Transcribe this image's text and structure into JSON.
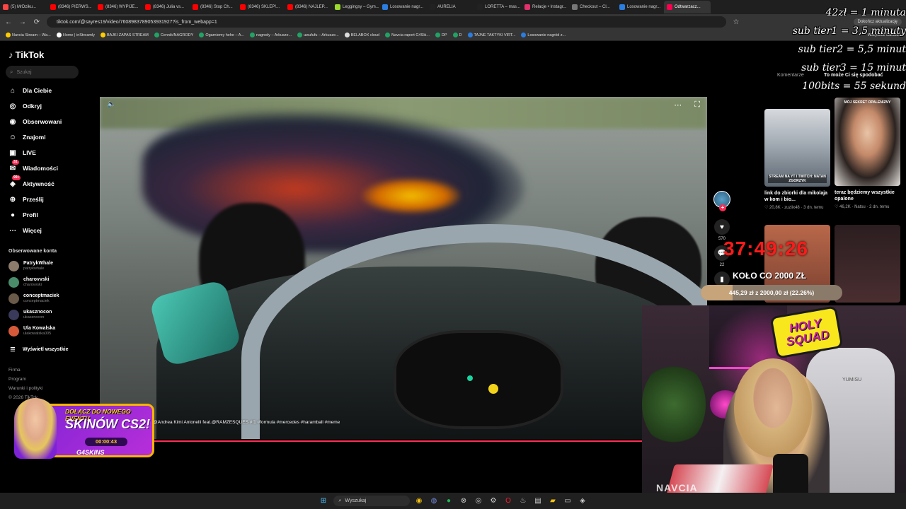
{
  "browser": {
    "tabs": [
      {
        "label": "(5) MrDziku...",
        "color": "#ff4444",
        "active": false
      },
      {
        "label": "(8346) PIERWS...",
        "color": "#ff0000",
        "active": false
      },
      {
        "label": "(8346) WYPIJE...",
        "color": "#ff0000",
        "active": false
      },
      {
        "label": "(8346) Julia vs...",
        "color": "#ff0000",
        "active": false
      },
      {
        "label": "(8346) Stop Ch...",
        "color": "#ff0000",
        "active": false
      },
      {
        "label": "(8346) SKLEP!...",
        "color": "#ff0000",
        "active": false
      },
      {
        "label": "(8346) NAJLEP...",
        "color": "#ff0000",
        "active": false
      },
      {
        "label": "Leggingsy – Gym...",
        "color": "#9cd92d",
        "active": false
      },
      {
        "label": "Losowanie nagr...",
        "color": "#2a7de1",
        "active": false
      },
      {
        "label": "AURELIA",
        "color": "#222222",
        "active": false
      },
      {
        "label": "LORETTA – mas...",
        "color": "#222222",
        "active": false
      },
      {
        "label": "Relacje • Instagr...",
        "color": "#e1306c",
        "active": false
      },
      {
        "label": "Checkout – Cl...",
        "color": "#777777",
        "active": false
      },
      {
        "label": "Losowanie nagr...",
        "color": "#2a7de1",
        "active": false
      },
      {
        "label": "Odtwarzacz...",
        "color": "#ff0050",
        "active": true
      }
    ],
    "url": "tiktok.com/@sayres19/video/7608983789053931927?is_from_webapp=1",
    "update_label": "Dokończ aktualizację",
    "all_bookmarks": "Wszystkie zakładki",
    "bookmarks": [
      {
        "label": "Navcia Stream – Wa...",
        "color": "#ffcc00"
      },
      {
        "label": "Home | inStreamly",
        "color": "#ffffff"
      },
      {
        "label": "BAJKI ZAPAS STREAM",
        "color": "#ffcc00"
      },
      {
        "label": "Cennik/NAGRODY",
        "color": "#21a366"
      },
      {
        "label": "Ogarniemy hehe – A...",
        "color": "#21a366"
      },
      {
        "label": "nagrody – Arkusze...",
        "color": "#21a366"
      },
      {
        "label": "uwufufu – Arkusze...",
        "color": "#21a366"
      },
      {
        "label": "BELABOX cloud",
        "color": "#dddddd"
      },
      {
        "label": "Navcia raport G4Ski...",
        "color": "#21a366"
      },
      {
        "label": "DP",
        "color": "#21a366"
      },
      {
        "label": "D",
        "color": "#21a366"
      },
      {
        "label": "TAJNE TAKTYKI VIRT...",
        "color": "#2a7de1"
      },
      {
        "label": "Losowanie nagród z...",
        "color": "#2a7de1"
      }
    ]
  },
  "tiktok": {
    "logo": "TikTok",
    "search_placeholder": "Szukaj",
    "nav": [
      {
        "label": "Dla Ciebie",
        "icon": "home-icon"
      },
      {
        "label": "Odkryj",
        "icon": "compass-icon"
      },
      {
        "label": "Obserwowani",
        "icon": "following-icon"
      },
      {
        "label": "Znajomi",
        "icon": "friends-icon"
      },
      {
        "label": "LIVE",
        "icon": "live-icon"
      },
      {
        "label": "Wiadomości",
        "icon": "messages-icon",
        "badge": "31"
      },
      {
        "label": "Aktywność",
        "icon": "activity-icon",
        "badge": "99+"
      },
      {
        "label": "Prześlij",
        "icon": "upload-icon"
      },
      {
        "label": "Profil",
        "icon": "profile-icon"
      },
      {
        "label": "Więcej",
        "icon": "more-icon"
      }
    ],
    "following_title": "Obserwowane konta",
    "following": [
      {
        "name": "PatrykWhale",
        "handle": "patrykwhale",
        "color": "#8c7b6a"
      },
      {
        "name": "charovvski",
        "handle": "charovvski",
        "color": "#4a8c6a"
      },
      {
        "name": "conceptmaciek",
        "handle": "conceptmaciek",
        "color": "#6a5a4a"
      },
      {
        "name": "ukasznocon",
        "handle": "ukasznocon",
        "color": "#3a3a5a"
      },
      {
        "name": "Ula Kowalska",
        "handle": "ulakowalska005",
        "color": "#d65a3a"
      }
    ],
    "show_all": "Wyświetl wszystkie",
    "footer": [
      "Firma",
      "Program",
      "Warunki i polityki",
      "© 2026 TikTok"
    ],
    "caption": "@Andrea Kimi Antonelli feat.@RAMZESQUES  #f1 #formula #mercedes #haramball #meme",
    "likes": "570",
    "comments": "22",
    "tabs": {
      "comments": "Komentarze",
      "answer": "To może Ci się spodobać"
    },
    "recommended": [
      {
        "desc": "link do zbiorki dla mikolaja w kom i bio...",
        "user": "zuziix48",
        "likes": "20,8K",
        "when": "3 dn. temu",
        "overlay": "STREAM NA YT I TWITCH: NATAN ZGORZYK"
      },
      {
        "desc": "teraz będziemy wszystkie opalone",
        "user": "Natsu",
        "likes": "46,2K",
        "when": "2 dn. temu",
        "overlay": "MÓJ SEKRET OPALENIZNY"
      }
    ]
  },
  "overlays": {
    "rates": [
      "42zł = 1 minuta",
      "sub tier1 = 3,5 minuty",
      "sub tier2 = 5,5 minut",
      "sub tier3 = 15 minut",
      "100bits = 55 sekund"
    ],
    "timer": "37:49:26",
    "goal_title": "KOŁO CO 2000 ZŁ",
    "goal_text": "445,29 zł z 2000,00 zł (22.26%)",
    "goal_fraction": 0.2226,
    "stream_name": "NAVCIA",
    "holy_squad": [
      "HOLY",
      "SQUAD"
    ],
    "chair_brand": "YUMISU",
    "event_line1": "DOŁĄCZ DO NOWEGO EVENTU",
    "event_line2": "SKINÓW CS2!",
    "event_countdown": "00:00:43",
    "event_brand": "G4SKINS"
  },
  "taskbar": {
    "search_placeholder": "Wyszukaj"
  }
}
